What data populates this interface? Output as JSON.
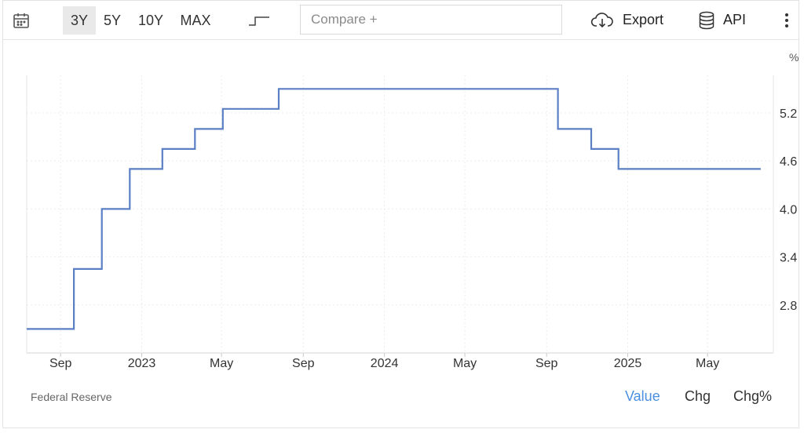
{
  "toolbar": {
    "ranges": [
      {
        "label": "3Y",
        "active": true
      },
      {
        "label": "5Y",
        "active": false
      },
      {
        "label": "10Y",
        "active": false
      },
      {
        "label": "MAX",
        "active": false
      }
    ],
    "compare_placeholder": "Compare +",
    "export_label": "Export",
    "api_label": "API",
    "icons": [
      "calendar-icon",
      "step-chart-icon",
      "cloud-download-icon",
      "database-icon",
      "more-vertical-icon"
    ]
  },
  "footer": {
    "source": "Federal Reserve",
    "modes": [
      {
        "label": "Value",
        "active": true
      },
      {
        "label": "Chg",
        "active": false
      },
      {
        "label": "Chg%",
        "active": false
      }
    ]
  },
  "colors": {
    "line": "#5b7fc4",
    "active_mode": "#4a8fe0",
    "active_range_bg": "#e9e9e9"
  },
  "chart_data": {
    "type": "line",
    "step": true,
    "unit_label": "%",
    "y_axis_position": "right",
    "grid": true,
    "ylim": [
      2.2,
      5.67
    ],
    "y_ticks": [
      2.8,
      3.4,
      4.0,
      4.6,
      5.2
    ],
    "x_range": [
      "2022-07-12",
      "2025-08-08"
    ],
    "x_ticks": [
      {
        "label": "Sep",
        "date": "2022-09-01"
      },
      {
        "label": "2023",
        "date": "2023-01-01"
      },
      {
        "label": "May",
        "date": "2023-05-01"
      },
      {
        "label": "Sep",
        "date": "2023-09-01"
      },
      {
        "label": "2024",
        "date": "2024-01-01"
      },
      {
        "label": "May",
        "date": "2024-05-01"
      },
      {
        "label": "Sep",
        "date": "2024-09-01"
      },
      {
        "label": "2025",
        "date": "2025-01-01"
      },
      {
        "label": "May",
        "date": "2025-05-01"
      }
    ],
    "series": [
      {
        "points": [
          {
            "date": "2022-07-12",
            "value": 2.5
          },
          {
            "date": "2022-09-21",
            "value": 3.25
          },
          {
            "date": "2022-11-02",
            "value": 4.0
          },
          {
            "date": "2022-12-14",
            "value": 4.5
          },
          {
            "date": "2023-02-01",
            "value": 4.75
          },
          {
            "date": "2023-03-22",
            "value": 5.0
          },
          {
            "date": "2023-05-03",
            "value": 5.25
          },
          {
            "date": "2023-07-26",
            "value": 5.5
          },
          {
            "date": "2024-09-18",
            "value": 5.0
          },
          {
            "date": "2024-11-07",
            "value": 4.75
          },
          {
            "date": "2024-12-18",
            "value": 4.5
          },
          {
            "date": "2025-07-20",
            "value": 4.5
          }
        ]
      }
    ]
  }
}
